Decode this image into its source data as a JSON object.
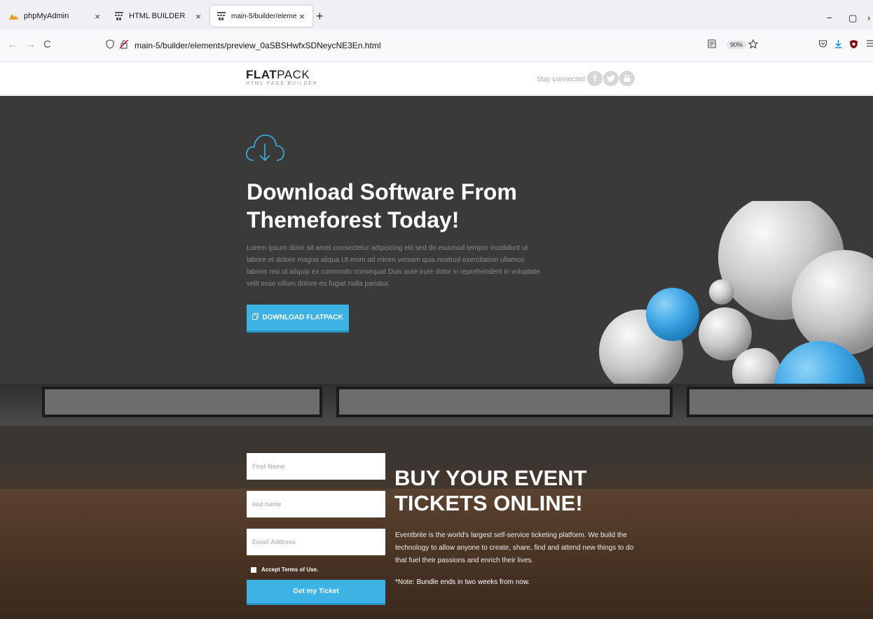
{
  "browser": {
    "tabs": [
      {
        "title": "phpMyAdmin",
        "close": "×",
        "active": false
      },
      {
        "title": "HTML BUILDER",
        "close": "×",
        "active": false
      },
      {
        "title": "main-5/builder/elements/previ",
        "close": "×",
        "active": true
      }
    ],
    "new_tab": "+",
    "url": "main-5/builder/elements/preview_0aSBSHwfxSDNeycNE3En.html",
    "zoom": "90%",
    "window_controls": [
      "−",
      "▢",
      "›"
    ],
    "nav": {
      "back": "←",
      "forward": "→",
      "reload": "C"
    },
    "colors": {
      "active_tab": "#ffffff",
      "tabbar": "#f0f0f4"
    }
  },
  "site": {
    "logo_bold": "FLAT",
    "logo_light": "PACK",
    "logo_sub": "HTML PAGE BUILDER",
    "stay_connected": "Stay connected",
    "social": [
      "facebook-icon",
      "twitter-icon",
      "youtube-icon"
    ]
  },
  "hero": {
    "icon": "cloud-download-icon",
    "title_line1": "Download Software From",
    "title_line2": "Themeforest Today!",
    "text": "Lorem ipsum dolor sit amet consectetur adipiscing elit sed do eiusmod tempor incididunt ut labore et dolore magna aliqua Ut enim ad minim veniam quis nostrud exercitation ullamco laboris nisi ut aliquip ex commodo consequat Duis aute irure dolor in reprehenderit in voluptate velit esse cillum dolore eu fugiat nulla pariatur.",
    "button_label": "DOWNLOAD FLATPACK",
    "button_icon": "copy-icon",
    "colors": {
      "background": "#3a3a3a",
      "accent": "#3cb3e4"
    }
  },
  "event": {
    "first_name_placeholder": "First Name",
    "last_name_placeholder": "last name",
    "email_placeholder": "Email Address",
    "terms_label": "Accept Terms of Use.",
    "button_label": "Get my Ticket",
    "title_line1": "BUY YOUR EVENT",
    "title_line2": "TICKETS ONLINE!",
    "text": "Eventbrite is the world's largest self-service ticketing platform. We build the technology to allow anyone to create, share, find and attend new things to do that fuel their passions and enrich their lives.",
    "note": "*Note: Bundle ends in two weeks from now."
  }
}
